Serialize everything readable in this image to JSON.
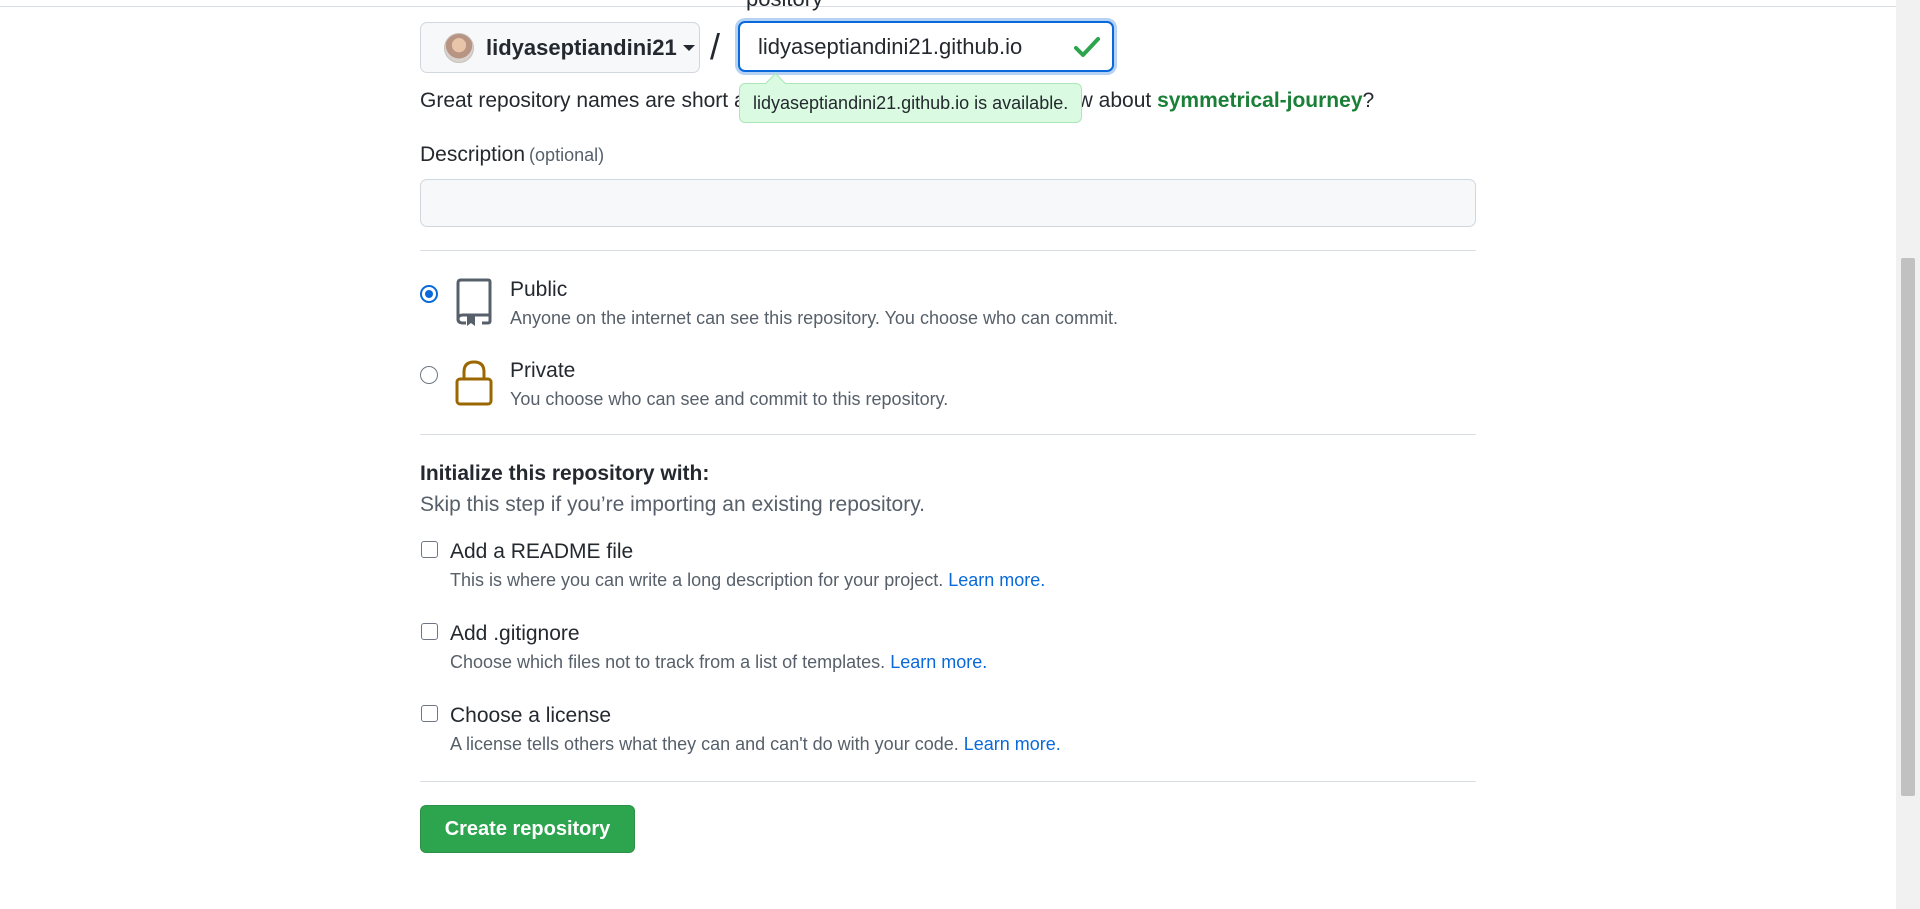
{
  "header": {
    "peek_text": "pository"
  },
  "owner": {
    "name": "lidyaseptiandini21"
  },
  "separator": "/",
  "repo_name": {
    "value": "lidyaseptiandini21.github.io"
  },
  "availability": {
    "tooltip": "lidyaseptiandini21.github.io is available.",
    "hint_start": "Great repository names are short a",
    "hint_mid": "ow about ",
    "suggestion": "symmetrical-journey",
    "hint_end": "?"
  },
  "description": {
    "label": "Description",
    "optional": "(optional)",
    "value": ""
  },
  "visibility": {
    "public": {
      "title": "Public",
      "subtitle": "Anyone on the internet can see this repository. You choose who can commit.",
      "selected": true
    },
    "private": {
      "title": "Private",
      "subtitle": "You choose who can see and commit to this repository.",
      "selected": false
    }
  },
  "initialize": {
    "title": "Initialize this repository with:",
    "subtitle": "Skip this step if you’re importing an existing repository.",
    "options": [
      {
        "title": "Add a README file",
        "subtitle": "This is where you can write a long description for your project. ",
        "link": "Learn more."
      },
      {
        "title": "Add .gitignore",
        "subtitle": "Choose which files not to track from a list of templates. ",
        "link": "Learn more."
      },
      {
        "title": "Choose a license",
        "subtitle": "A license tells others what they can and can't do with your code. ",
        "link": "Learn more."
      }
    ]
  },
  "create_button": "Create repository",
  "colors": {
    "accent_blue": "#0969da",
    "success_green": "#2da44e",
    "private_lock": "#9a6700"
  }
}
